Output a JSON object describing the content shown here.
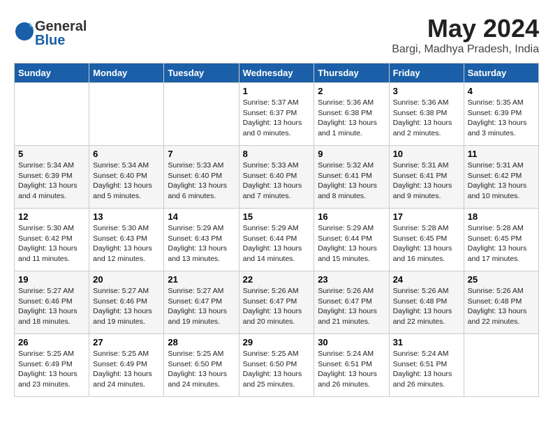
{
  "header": {
    "logo_general": "General",
    "logo_blue": "Blue",
    "month_title": "May 2024",
    "location": "Bargi, Madhya Pradesh, India"
  },
  "days_of_week": [
    "Sunday",
    "Monday",
    "Tuesday",
    "Wednesday",
    "Thursday",
    "Friday",
    "Saturday"
  ],
  "weeks": [
    [
      {
        "day": "",
        "info": ""
      },
      {
        "day": "",
        "info": ""
      },
      {
        "day": "",
        "info": ""
      },
      {
        "day": "1",
        "info": "Sunrise: 5:37 AM\nSunset: 6:37 PM\nDaylight: 13 hours\nand 0 minutes."
      },
      {
        "day": "2",
        "info": "Sunrise: 5:36 AM\nSunset: 6:38 PM\nDaylight: 13 hours\nand 1 minute."
      },
      {
        "day": "3",
        "info": "Sunrise: 5:36 AM\nSunset: 6:38 PM\nDaylight: 13 hours\nand 2 minutes."
      },
      {
        "day": "4",
        "info": "Sunrise: 5:35 AM\nSunset: 6:39 PM\nDaylight: 13 hours\nand 3 minutes."
      }
    ],
    [
      {
        "day": "5",
        "info": "Sunrise: 5:34 AM\nSunset: 6:39 PM\nDaylight: 13 hours\nand 4 minutes."
      },
      {
        "day": "6",
        "info": "Sunrise: 5:34 AM\nSunset: 6:40 PM\nDaylight: 13 hours\nand 5 minutes."
      },
      {
        "day": "7",
        "info": "Sunrise: 5:33 AM\nSunset: 6:40 PM\nDaylight: 13 hours\nand 6 minutes."
      },
      {
        "day": "8",
        "info": "Sunrise: 5:33 AM\nSunset: 6:40 PM\nDaylight: 13 hours\nand 7 minutes."
      },
      {
        "day": "9",
        "info": "Sunrise: 5:32 AM\nSunset: 6:41 PM\nDaylight: 13 hours\nand 8 minutes."
      },
      {
        "day": "10",
        "info": "Sunrise: 5:31 AM\nSunset: 6:41 PM\nDaylight: 13 hours\nand 9 minutes."
      },
      {
        "day": "11",
        "info": "Sunrise: 5:31 AM\nSunset: 6:42 PM\nDaylight: 13 hours\nand 10 minutes."
      }
    ],
    [
      {
        "day": "12",
        "info": "Sunrise: 5:30 AM\nSunset: 6:42 PM\nDaylight: 13 hours\nand 11 minutes."
      },
      {
        "day": "13",
        "info": "Sunrise: 5:30 AM\nSunset: 6:43 PM\nDaylight: 13 hours\nand 12 minutes."
      },
      {
        "day": "14",
        "info": "Sunrise: 5:29 AM\nSunset: 6:43 PM\nDaylight: 13 hours\nand 13 minutes."
      },
      {
        "day": "15",
        "info": "Sunrise: 5:29 AM\nSunset: 6:44 PM\nDaylight: 13 hours\nand 14 minutes."
      },
      {
        "day": "16",
        "info": "Sunrise: 5:29 AM\nSunset: 6:44 PM\nDaylight: 13 hours\nand 15 minutes."
      },
      {
        "day": "17",
        "info": "Sunrise: 5:28 AM\nSunset: 6:45 PM\nDaylight: 13 hours\nand 16 minutes."
      },
      {
        "day": "18",
        "info": "Sunrise: 5:28 AM\nSunset: 6:45 PM\nDaylight: 13 hours\nand 17 minutes."
      }
    ],
    [
      {
        "day": "19",
        "info": "Sunrise: 5:27 AM\nSunset: 6:46 PM\nDaylight: 13 hours\nand 18 minutes."
      },
      {
        "day": "20",
        "info": "Sunrise: 5:27 AM\nSunset: 6:46 PM\nDaylight: 13 hours\nand 19 minutes."
      },
      {
        "day": "21",
        "info": "Sunrise: 5:27 AM\nSunset: 6:47 PM\nDaylight: 13 hours\nand 19 minutes."
      },
      {
        "day": "22",
        "info": "Sunrise: 5:26 AM\nSunset: 6:47 PM\nDaylight: 13 hours\nand 20 minutes."
      },
      {
        "day": "23",
        "info": "Sunrise: 5:26 AM\nSunset: 6:47 PM\nDaylight: 13 hours\nand 21 minutes."
      },
      {
        "day": "24",
        "info": "Sunrise: 5:26 AM\nSunset: 6:48 PM\nDaylight: 13 hours\nand 22 minutes."
      },
      {
        "day": "25",
        "info": "Sunrise: 5:26 AM\nSunset: 6:48 PM\nDaylight: 13 hours\nand 22 minutes."
      }
    ],
    [
      {
        "day": "26",
        "info": "Sunrise: 5:25 AM\nSunset: 6:49 PM\nDaylight: 13 hours\nand 23 minutes."
      },
      {
        "day": "27",
        "info": "Sunrise: 5:25 AM\nSunset: 6:49 PM\nDaylight: 13 hours\nand 24 minutes."
      },
      {
        "day": "28",
        "info": "Sunrise: 5:25 AM\nSunset: 6:50 PM\nDaylight: 13 hours\nand 24 minutes."
      },
      {
        "day": "29",
        "info": "Sunrise: 5:25 AM\nSunset: 6:50 PM\nDaylight: 13 hours\nand 25 minutes."
      },
      {
        "day": "30",
        "info": "Sunrise: 5:24 AM\nSunset: 6:51 PM\nDaylight: 13 hours\nand 26 minutes."
      },
      {
        "day": "31",
        "info": "Sunrise: 5:24 AM\nSunset: 6:51 PM\nDaylight: 13 hours\nand 26 minutes."
      },
      {
        "day": "",
        "info": ""
      }
    ]
  ]
}
